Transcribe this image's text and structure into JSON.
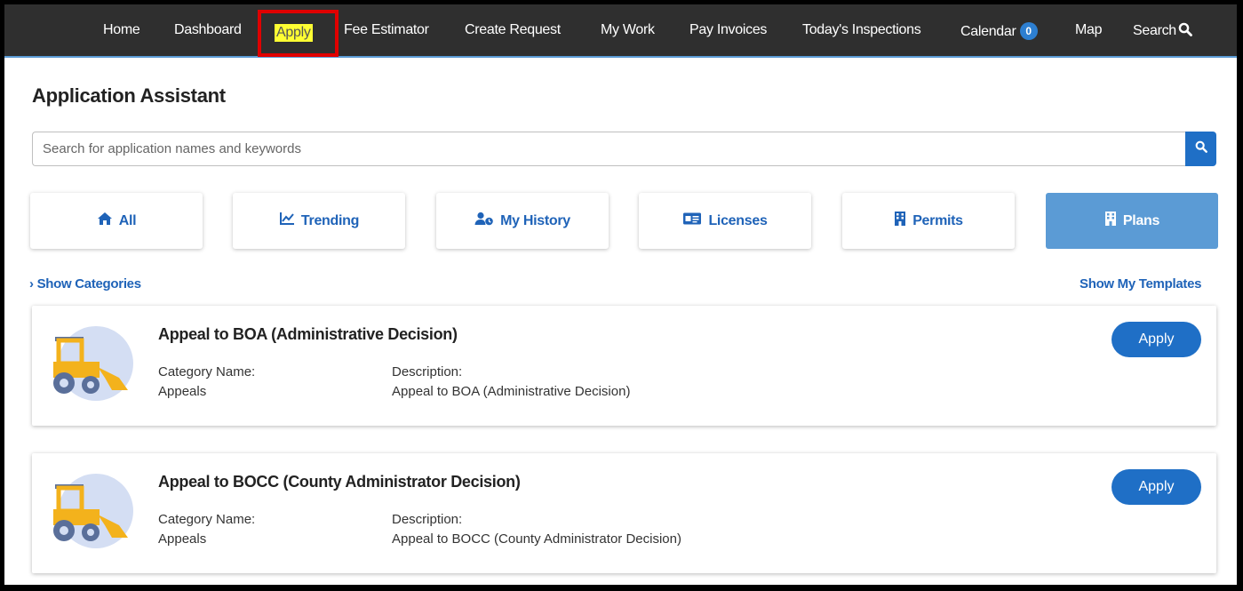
{
  "nav": {
    "items": [
      "Home",
      "Dashboard",
      "Apply",
      "Fee Estimator",
      "Create Request",
      "My Work",
      "Pay Invoices",
      "Today's Inspections",
      "Calendar",
      "Map",
      "Search"
    ],
    "calendar_count": "0"
  },
  "page_title": "Application Assistant",
  "search": {
    "placeholder": "Search for application names and keywords",
    "value": ""
  },
  "tiles": [
    {
      "label": "All",
      "icon": "home-icon"
    },
    {
      "label": "Trending",
      "icon": "trending-chart-icon"
    },
    {
      "label": "My History",
      "icon": "users-history-icon"
    },
    {
      "label": "Licenses",
      "icon": "id-card-icon"
    },
    {
      "label": "Permits",
      "icon": "building-icon"
    },
    {
      "label": "Plans",
      "icon": "building-icon",
      "active": true
    }
  ],
  "show_categories": "Show Categories",
  "show_templates": "Show My Templates",
  "cards": [
    {
      "title": "Appeal to BOA (Administrative Decision)",
      "category_label": "Category Name:",
      "category": "Appeals",
      "description_label": "Description:",
      "description": "Appeal to BOA (Administrative Decision)",
      "button": "Apply"
    },
    {
      "title": "Appeal to BOCC (County Administrator Decision)",
      "category_label": "Category Name:",
      "category": "Appeals",
      "description_label": "Description:",
      "description": "Appeal to BOCC (County Administrator Decision)",
      "button": "Apply"
    }
  ],
  "colors": {
    "nav_bg": "#2f2f2f",
    "accent": "#1f6fc6",
    "active_tile": "#5b9bd5",
    "highlight": "#ffff33",
    "red_box": "#e00000"
  }
}
